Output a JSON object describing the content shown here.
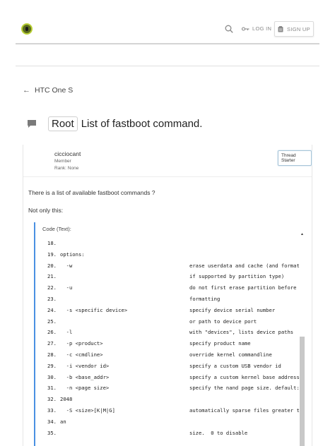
{
  "header": {
    "login_label": "LOG IN",
    "signup_label": "SIGN UP"
  },
  "breadcrumb": {
    "label": "HTC One S"
  },
  "thread": {
    "prefix": "Root",
    "title": "List of fastboot command."
  },
  "post": {
    "author": "cicciocant",
    "role": "Member",
    "rank": "Rank: None",
    "badge": "Thread Starter",
    "paragraphs": [
      "There is a list of available fastboot commands ?",
      "Not only this:"
    ],
    "code_label": "Code (Text):",
    "code_lines": [
      {
        "n": "18.",
        "a": "",
        "b": ""
      },
      {
        "n": "19.",
        "a": "options:",
        "b": ""
      },
      {
        "n": "20.",
        "a": "  -w",
        "b": "erase userdata and cache (and format"
      },
      {
        "n": "21.",
        "a": "",
        "b": "if supported by partition type)"
      },
      {
        "n": "22.",
        "a": "  -u",
        "b": "do not first erase partition before"
      },
      {
        "n": "23.",
        "a": "",
        "b": "formatting"
      },
      {
        "n": "24.",
        "a": "  -s <specific device>",
        "b": "specify device serial number"
      },
      {
        "n": "25.",
        "a": "",
        "b": "or path to device port"
      },
      {
        "n": "26.",
        "a": "  -l",
        "b": "with \"devices\", lists device paths"
      },
      {
        "n": "27.",
        "a": "  -p <product>",
        "b": "specify product name"
      },
      {
        "n": "28.",
        "a": "  -c <cmdline>",
        "b": "override kernel commandline"
      },
      {
        "n": "29.",
        "a": "  -i <vendor id>",
        "b": "specify a custom USB vendor id"
      },
      {
        "n": "30.",
        "a": "  -b <base_addr>",
        "b": "specify a custom kernel base address"
      },
      {
        "n": "31.",
        "a": "  -n <page size>",
        "b": "specify the nand page size. default:"
      },
      {
        "n": "32.",
        "a": "2048",
        "b": ""
      },
      {
        "n": "33.",
        "a": "  -S <size>[K|M|G]",
        "b": "automatically sparse files greater th"
      },
      {
        "n": "34.",
        "a": "an",
        "b": ""
      },
      {
        "n": "35.",
        "a": "",
        "b": "size.  0 to disable"
      }
    ]
  },
  "icons": {
    "search": "search-icon",
    "key": "key-icon",
    "signup": "clipboard-icon",
    "back": "arrow-left-icon",
    "thread": "chat-bubble-icon"
  },
  "colors": {
    "accent": "#4a90e2",
    "badge_border": "#a9c5d8",
    "logo": "#b9d035"
  }
}
